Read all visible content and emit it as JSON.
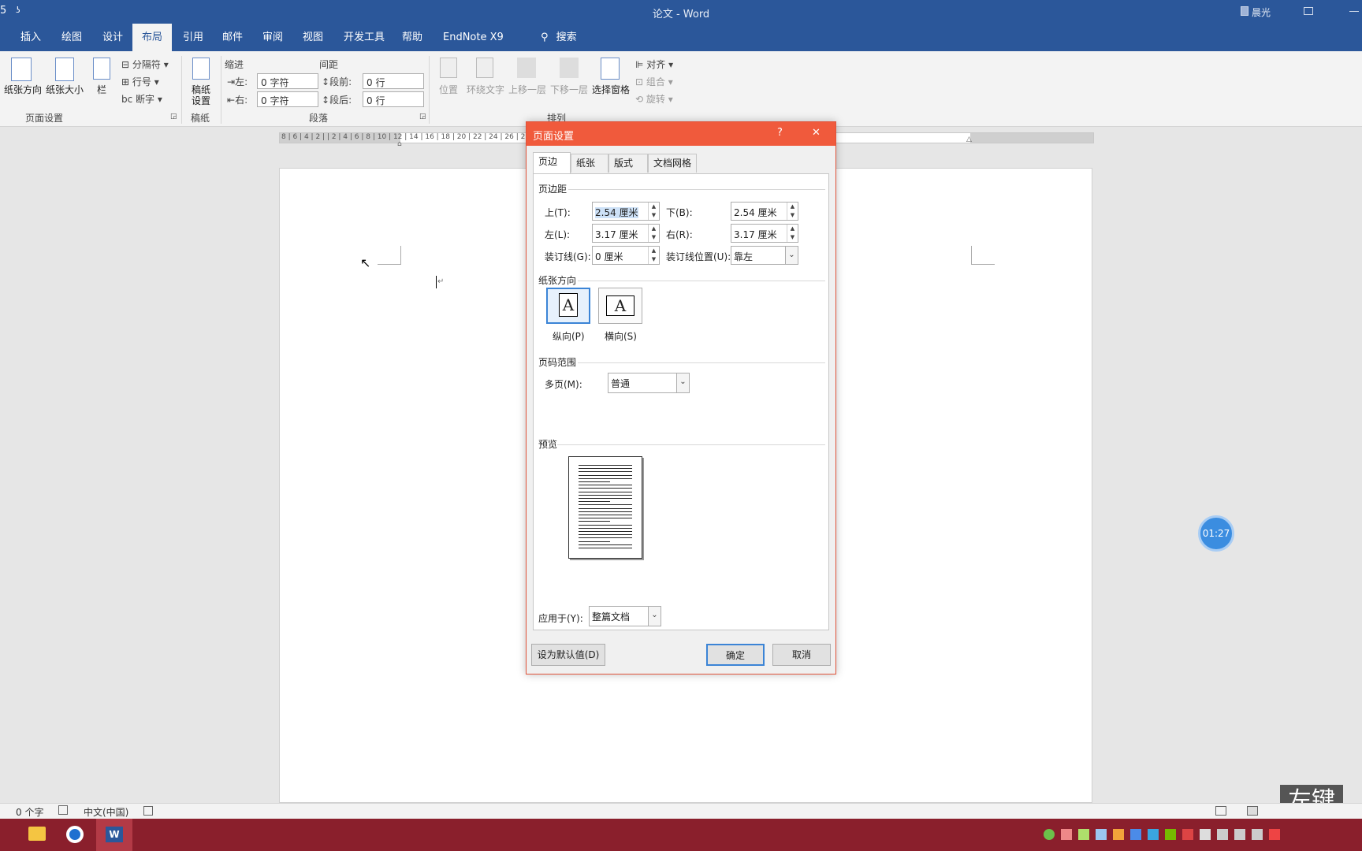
{
  "titlebar": {
    "title": "论文 - Word",
    "user": "晨光",
    "quick_access": "ʖ",
    "quick_save": "5"
  },
  "tabs": [
    "插入",
    "绘图",
    "设计",
    "布局",
    "引用",
    "邮件",
    "审阅",
    "视图",
    "开发工具",
    "帮助",
    "EndNote X9"
  ],
  "active_tab": "布局",
  "search_label": "搜索",
  "ribbon": {
    "page_setup": {
      "orientation": "纸张方向",
      "size": "纸张大小",
      "columns": "栏",
      "breaks": "分隔符",
      "line_numbers": "行号",
      "hyphenation": "断字",
      "group_label": "页面设置"
    },
    "manuscript": {
      "button": "稿纸设置",
      "line1": "稿纸",
      "line2": "设置",
      "group_label": "稿纸"
    },
    "indent": {
      "header": "缩进",
      "left_label": "左:",
      "left_value": "0 字符",
      "right_label": "右:",
      "right_value": "0 字符"
    },
    "spacing": {
      "header": "间距",
      "before_label": "段前:",
      "before_value": "0 行",
      "after_label": "段后:",
      "after_value": "0 行"
    },
    "paragraph_label": "段落",
    "arrange": {
      "position": "位置",
      "wrap_text": "环绕文字",
      "bring_forward": "上移一层",
      "send_backward": "下移一层",
      "selection_pane": "选择窗格",
      "align": "对齐",
      "group": "组合",
      "rotate": "旋转",
      "group_label": "排列"
    }
  },
  "ruler_text": "8 | 6 | 4 | 2 |     | 2 | 4 | 6 | 8 | 10 | 12 | 14 | 16 | 18 | 20 | 22 | 24 | 26 | 28 | 30 | 32 | 34 | 36 | 38 | 40 | 42 | 44 | 46 | 48",
  "paragraph_mark": "↵",
  "timer": "01:27",
  "overlay_text": "左键",
  "statusbar": {
    "words": "0 个字",
    "language": "中文(中国)"
  },
  "dialog": {
    "title": "页面设置",
    "help": "?",
    "close": "✕",
    "tabs": [
      "页边距",
      "纸张",
      "版式",
      "文档网格"
    ],
    "active_tab": "页边距",
    "margins_section": "页边距",
    "top_label": "上(T):",
    "top_value": "2.54 厘米",
    "bottom_label": "下(B):",
    "bottom_value": "2.54 厘米",
    "left_label": "左(L):",
    "left_value": "3.17 厘米",
    "right_label": "右(R):",
    "right_value": "3.17 厘米",
    "gutter_label": "装订线(G):",
    "gutter_value": "0 厘米",
    "gutter_pos_label": "装订线位置(U):",
    "gutter_pos_value": "靠左",
    "orientation_section": "纸张方向",
    "portrait_label": "纵向(P)",
    "landscape_label": "横向(S)",
    "orientation_glyph": "A",
    "pages_section": "页码范围",
    "multiple_pages_label": "多页(M):",
    "multiple_pages_value": "普通",
    "preview_section": "预览",
    "apply_to_label": "应用于(Y):",
    "apply_to_value": "整篇文档",
    "set_default": "设为默认值(D)",
    "ok": "确定",
    "cancel": "取消"
  },
  "colors": {
    "word_blue": "#2b579a",
    "dialog_title": "#f05a3c",
    "taskbar": "#8a1f2c",
    "timer_blue": "#3b8de0"
  }
}
